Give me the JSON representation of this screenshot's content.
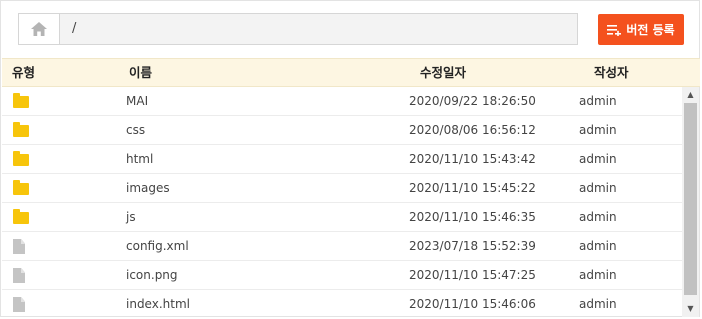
{
  "toolbar": {
    "home_icon": "home-icon",
    "path": "/",
    "register_label": "버전 등록",
    "register_icon": "list-add-icon",
    "register_color": "#f4511e"
  },
  "table": {
    "headers": {
      "type": "유형",
      "name": "이름",
      "modified": "수정일자",
      "author": "작성자"
    },
    "rows": [
      {
        "type": "folder",
        "name": "MAI",
        "modified": "2020/09/22 18:26:50",
        "author": "admin"
      },
      {
        "type": "folder",
        "name": "css",
        "modified": "2020/08/06 16:56:12",
        "author": "admin"
      },
      {
        "type": "folder",
        "name": "html",
        "modified": "2020/11/10 15:43:42",
        "author": "admin"
      },
      {
        "type": "folder",
        "name": "images",
        "modified": "2020/11/10 15:45:22",
        "author": "admin"
      },
      {
        "type": "folder",
        "name": "js",
        "modified": "2020/11/10 15:46:35",
        "author": "admin"
      },
      {
        "type": "file",
        "name": "config.xml",
        "modified": "2023/07/18 15:52:39",
        "author": "admin"
      },
      {
        "type": "file",
        "name": "icon.png",
        "modified": "2020/11/10 15:47:25",
        "author": "admin"
      },
      {
        "type": "file",
        "name": "index.html",
        "modified": "2020/11/10 15:46:06",
        "author": "admin"
      }
    ]
  },
  "colors": {
    "folder": "#f7c50b",
    "file": "#c4c4c4",
    "header_bg": "#fdf6e2"
  }
}
